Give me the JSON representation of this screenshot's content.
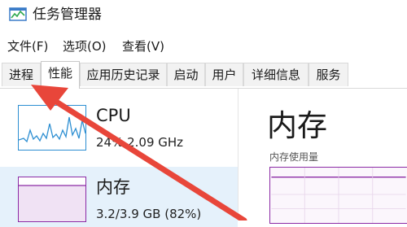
{
  "window": {
    "title": "任务管理器",
    "icon": "task-manager-icon"
  },
  "menu": {
    "file": "文件(F)",
    "options": "选项(O)",
    "view": "查看(V)"
  },
  "tabs": [
    {
      "label": "进程"
    },
    {
      "label": "性能",
      "active": true
    },
    {
      "label": "应用历史记录"
    },
    {
      "label": "启动"
    },
    {
      "label": "用户"
    },
    {
      "label": "详细信息"
    },
    {
      "label": "服务"
    }
  ],
  "perf_items": [
    {
      "title": "CPU",
      "subtitle": "24%  2.09 GHz",
      "color": "#2d8fd2"
    },
    {
      "title": "内存",
      "subtitle": "3.2/3.9 GB (82%)",
      "color": "#8b2aa5",
      "selected": true
    }
  ],
  "detail": {
    "title": "内存",
    "subtitle": "内存使用量"
  },
  "annotation": {
    "color": "#e8463a",
    "icon": "red-arrow-annotation"
  }
}
